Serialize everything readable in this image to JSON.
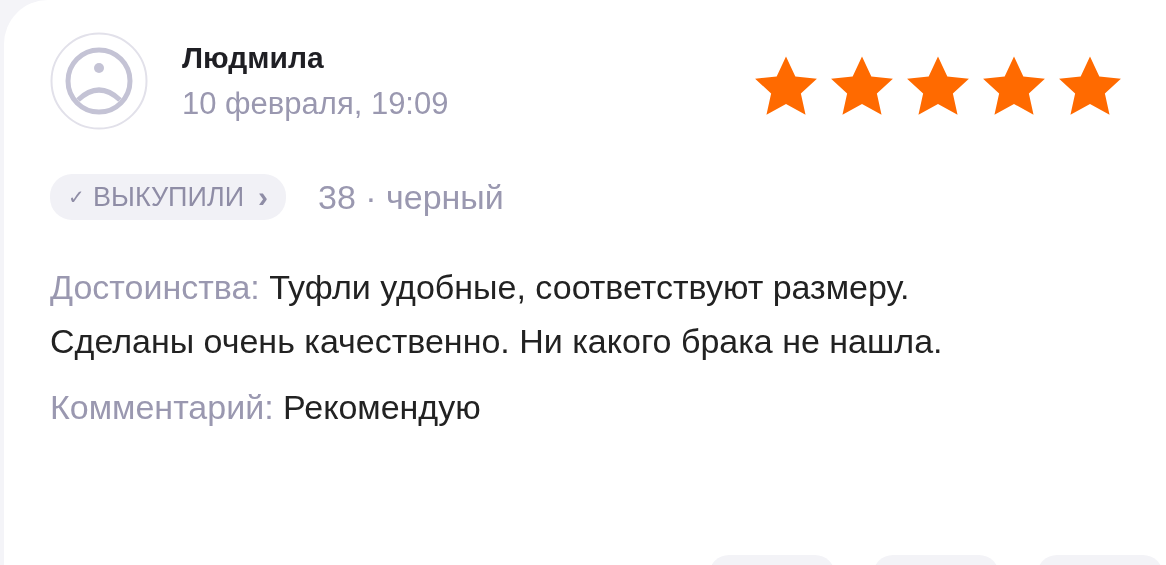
{
  "review": {
    "author": "Людмила",
    "date": "10 февраля, 19:09",
    "stars": 5,
    "badge": {
      "check": "✓",
      "label": "ВЫКУПИЛИ",
      "chevron": "›"
    },
    "variant": "38 · черный",
    "sections": [
      {
        "label": "Достоинства:",
        "text": "Туфли удобные, соответствуют размеру. Сделаны очень качественно. Ни какого брака не нашла."
      },
      {
        "label": "Комментарий:",
        "text": "Рекомендую"
      }
    ]
  }
}
